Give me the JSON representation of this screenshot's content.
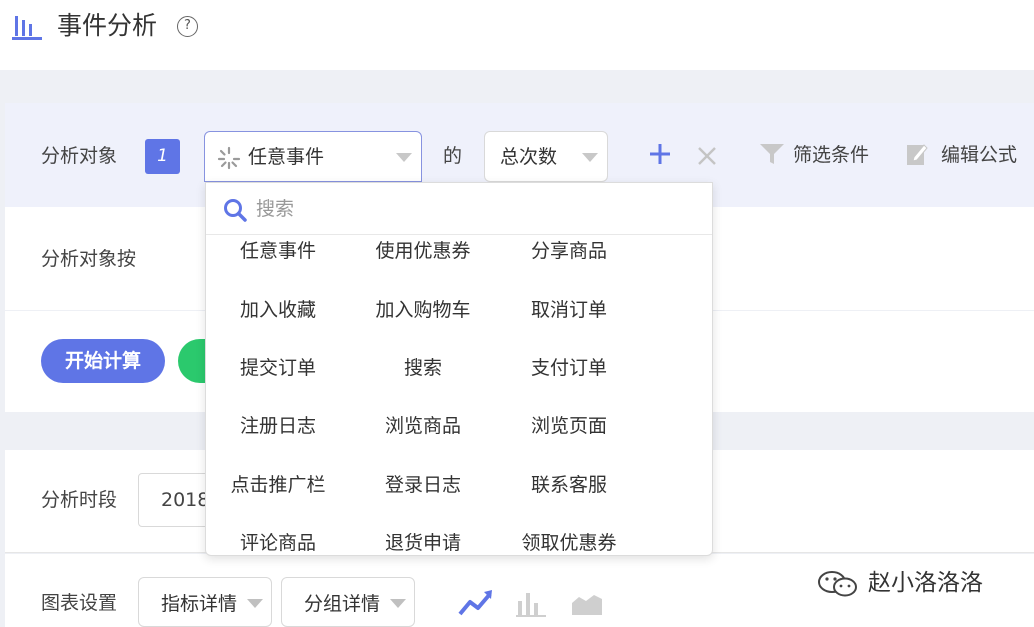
{
  "header": {
    "title": "事件分析",
    "help_glyph": "?"
  },
  "analysis_target": {
    "label": "分析对象",
    "index": "1",
    "event_select": "任意事件",
    "connector": "的",
    "measure_select": "总次数",
    "filter_label": "筛选条件",
    "formula_label": "编辑公式"
  },
  "group_by": {
    "label": "分析对象按"
  },
  "actions": {
    "start_label": "开始计算"
  },
  "period": {
    "label": "分析时段",
    "date_value": "2018"
  },
  "chart_settings": {
    "label": "图表设置",
    "metric_detail": "指标详情",
    "group_detail": "分组详情"
  },
  "dropdown": {
    "search_placeholder": "搜索",
    "options": [
      [
        "任意事件",
        "使用优惠券",
        "分享商品"
      ],
      [
        "加入收藏",
        "加入购物车",
        "取消订单"
      ],
      [
        "提交订单",
        "搜索",
        "支付订单"
      ],
      [
        "注册日志",
        "浏览商品",
        "浏览页面"
      ],
      [
        "点击推广栏",
        "登录日志",
        "联系客服"
      ],
      [
        "评论商品",
        "退货申请",
        "领取优惠券"
      ]
    ]
  },
  "watermark": {
    "text": "赵小洛洛洛"
  },
  "colors": {
    "accent": "#5f75e6",
    "green": "#2bc96d",
    "panel": "#eff1fb"
  }
}
